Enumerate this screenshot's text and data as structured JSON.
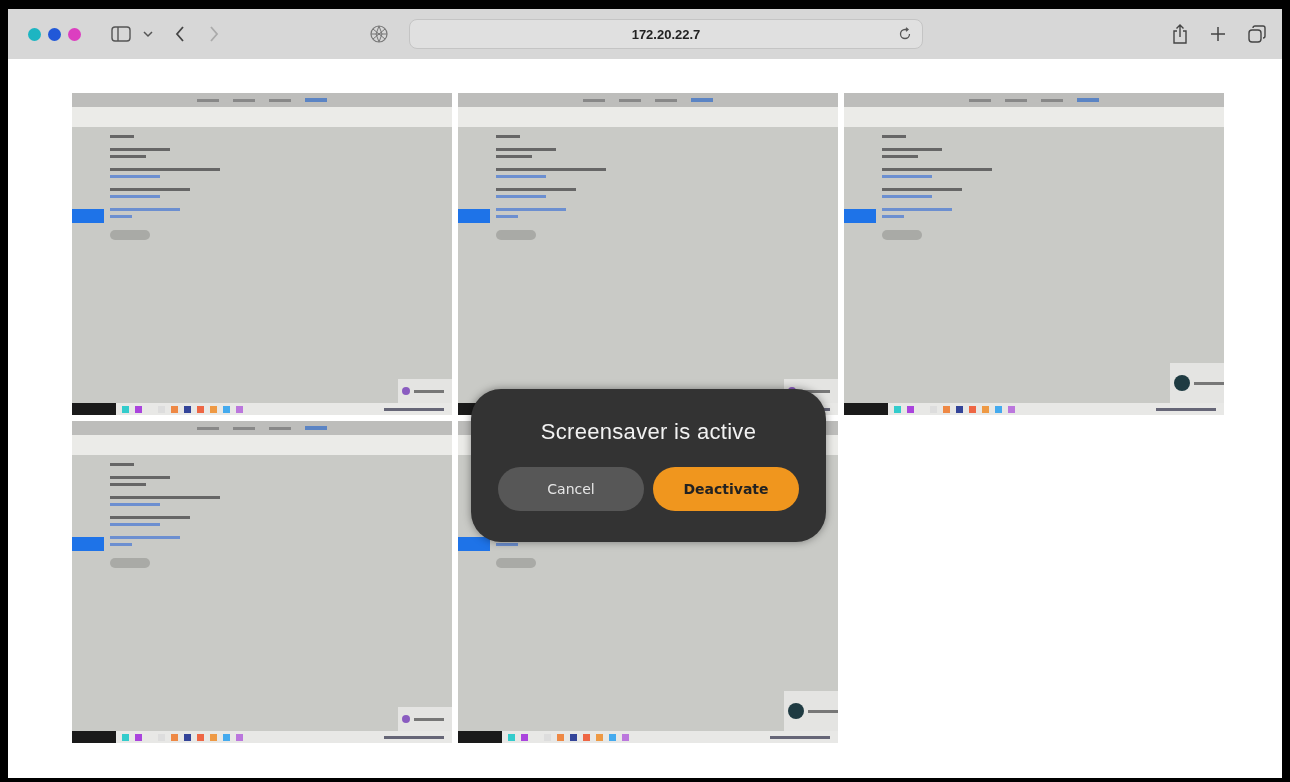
{
  "browser": {
    "address": "172.20.22.7"
  },
  "thumbnails": [
    {
      "kind": "app"
    },
    {
      "kind": "app"
    },
    {
      "kind": "avatar"
    },
    {
      "kind": "app"
    },
    {
      "kind": "avatar"
    }
  ],
  "dialog": {
    "title": "Screensaver is active",
    "buttons": [
      {
        "label": "Cancel",
        "kind": "secondary"
      },
      {
        "label": "Deactivate",
        "kind": "primary"
      }
    ]
  }
}
